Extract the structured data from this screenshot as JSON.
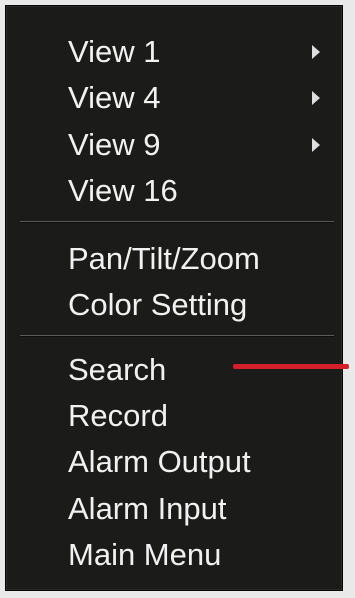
{
  "menu": {
    "groups": [
      {
        "items": [
          {
            "label": "View 1",
            "has_submenu": true
          },
          {
            "label": "View 4",
            "has_submenu": true
          },
          {
            "label": "View 9",
            "has_submenu": true
          },
          {
            "label": "View 16",
            "has_submenu": false
          }
        ]
      },
      {
        "items": [
          {
            "label": "Pan/Tilt/Zoom"
          },
          {
            "label": "Color Setting"
          }
        ]
      },
      {
        "items": [
          {
            "label": "Search"
          },
          {
            "label": "Record"
          },
          {
            "label": "Alarm Output"
          },
          {
            "label": "Alarm Input"
          },
          {
            "label": "Main Menu"
          }
        ]
      }
    ]
  },
  "annotation": {
    "pointer_color": "#d3202a",
    "points_to": "Search"
  },
  "colors": {
    "menu_background": "#1b1c1a",
    "text": "#f1f1f1"
  }
}
